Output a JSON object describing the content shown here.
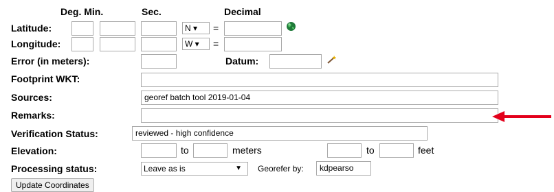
{
  "headers": {
    "deg_min": "Deg. Min.",
    "sec": "Sec.",
    "decimal": "Decimal"
  },
  "latitude": {
    "label": "Latitude:",
    "deg": "",
    "min": "",
    "sec": "",
    "hemisphere": "N ▾",
    "equals": "=",
    "decimal": ""
  },
  "longitude": {
    "label": "Longitude:",
    "deg": "",
    "min": "",
    "sec": "",
    "hemisphere": "W ▾",
    "equals": "=",
    "decimal": ""
  },
  "error": {
    "label": "Error (in meters):",
    "value": ""
  },
  "datum": {
    "label": "Datum:",
    "value": ""
  },
  "footprint": {
    "label": "Footprint WKT:",
    "value": ""
  },
  "sources": {
    "label": "Sources:",
    "value": "georef batch tool 2019-01-04"
  },
  "remarks": {
    "label": "Remarks:",
    "value": ""
  },
  "verification": {
    "label": "Verification Status:",
    "value": "reviewed - high confidence"
  },
  "elevation": {
    "label": "Elevation:",
    "from_m": "",
    "to1": "to",
    "to_m": "",
    "meters": "meters",
    "from_ft": "",
    "to2": "to",
    "to_ft": "",
    "feet": "feet"
  },
  "processing": {
    "label": "Processing status:",
    "selected": "Leave as is",
    "arrow": "▼",
    "georefer_label": "Georefer by:",
    "georefer_value": "kdpearso"
  },
  "update_button": "Update Coordinates",
  "colors": {
    "arrow": "#e3001b",
    "globe": "#2e8b57",
    "input_border": "#a9a9a9"
  }
}
